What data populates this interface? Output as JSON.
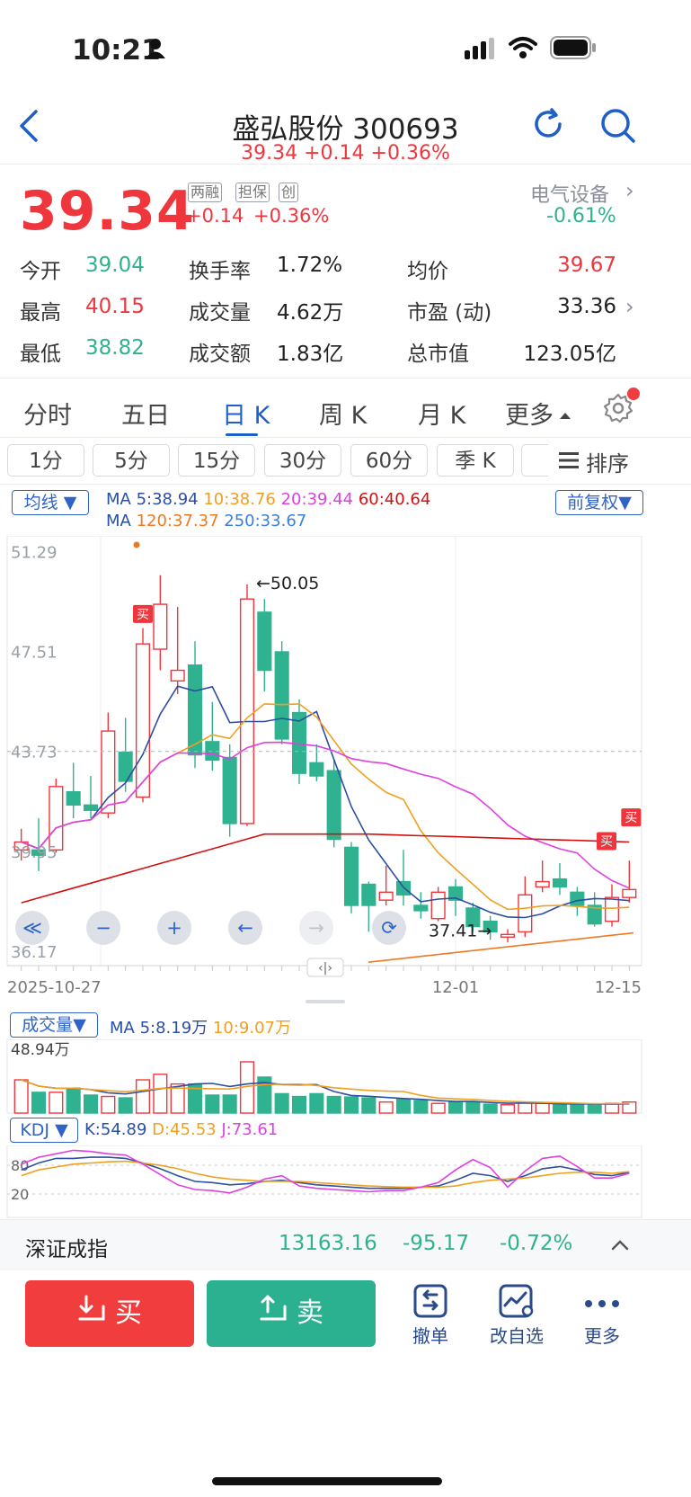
{
  "status_bar": {
    "time": "10:21"
  },
  "header": {
    "title": "盛弘股份 300693",
    "subtitle": "39.34 +0.14 +0.36%"
  },
  "quote": {
    "price": "39.34",
    "tags": [
      "两融",
      "担保",
      "创"
    ],
    "change": "+0.14",
    "change_pct": "+0.36%",
    "sector": "电气设备",
    "sector_pct": "-0.61%",
    "stats": [
      {
        "label": "今开",
        "value": "39.04",
        "color": "#2fb28f"
      },
      {
        "label": "换手率",
        "value": "1.72%",
        "color": "#222"
      },
      {
        "label": "均价",
        "value": "39.67",
        "color": "#f0363d"
      },
      {
        "label": "最高",
        "value": "40.15",
        "color": "#f0363d"
      },
      {
        "label": "成交量",
        "value": "4.62万",
        "color": "#222"
      },
      {
        "label": "市盈 (动)",
        "value": "33.36",
        "color": "#222"
      },
      {
        "label": "最低",
        "value": "38.82",
        "color": "#2fb28f"
      },
      {
        "label": "成交额",
        "value": "1.83亿",
        "color": "#222"
      },
      {
        "label": "总市值",
        "value": "123.05亿",
        "color": "#222"
      }
    ]
  },
  "tabs": [
    "分时",
    "五日",
    "日 K",
    "周 K",
    "月 K",
    "更多"
  ],
  "active_tab": "日 K",
  "subtabs": [
    "1分",
    "5分",
    "15分",
    "30分",
    "60分",
    "季 K"
  ],
  "sort_label": "排序",
  "ma_legend": {
    "selector": "均线",
    "fq": "前复权",
    "row1": [
      "MA",
      "5:38.94",
      "10:38.76",
      "20:39.44",
      "60:40.64"
    ],
    "row2": [
      "MA",
      "120:37.37",
      "250:33.67"
    ],
    "colors": {
      "ma5": "#2b4fa3",
      "ma10": "#f0a020",
      "ma20": "#e040e0",
      "ma60": "#d21010",
      "ma120": "#f07820",
      "ma250": "#3a7fe0"
    }
  },
  "kline": {
    "y_ticks": [
      "51.29",
      "47.51",
      "43.73",
      "39.95",
      "36.17"
    ],
    "x_ticks": [
      "2025-10-27",
      "12-01",
      "12-15"
    ],
    "high_marker": "←50.05",
    "low_marker": "37.41→",
    "buy_tag": "买",
    "candles": [
      {
        "o": 40.0,
        "c": 40.3,
        "h": 40.8,
        "l": 39.6
      },
      {
        "o": 40.0,
        "c": 39.8,
        "h": 41.2,
        "l": 39.2
      },
      {
        "o": 40.0,
        "c": 42.4,
        "h": 42.7,
        "l": 39.9
      },
      {
        "o": 42.2,
        "c": 41.7,
        "h": 43.3,
        "l": 41.2
      },
      {
        "o": 41.7,
        "c": 41.5,
        "h": 42.8,
        "l": 41.2
      },
      {
        "o": 41.4,
        "c": 44.5,
        "h": 45.2,
        "l": 41.2
      },
      {
        "o": 43.7,
        "c": 42.6,
        "h": 45.0,
        "l": 42.2
      },
      {
        "o": 42.0,
        "c": 47.8,
        "h": 48.4,
        "l": 41.8
      },
      {
        "o": 47.6,
        "c": 49.3,
        "h": 50.4,
        "l": 46.8
      },
      {
        "o": 46.4,
        "c": 46.8,
        "h": 49.2,
        "l": 45.9
      },
      {
        "o": 47.0,
        "c": 43.6,
        "h": 47.9,
        "l": 43.1
      },
      {
        "o": 44.1,
        "c": 43.4,
        "h": 45.6,
        "l": 43.0
      },
      {
        "o": 43.5,
        "c": 41.0,
        "h": 44.0,
        "l": 40.5
      },
      {
        "o": 41.0,
        "c": 49.5,
        "h": 50.05,
        "l": 40.9
      },
      {
        "o": 49.0,
        "c": 46.8,
        "h": 49.5,
        "l": 46.0
      },
      {
        "o": 47.5,
        "c": 44.2,
        "h": 47.9,
        "l": 44.0
      },
      {
        "o": 45.2,
        "c": 42.9,
        "h": 45.7,
        "l": 42.5
      },
      {
        "o": 43.3,
        "c": 42.8,
        "h": 44.0,
        "l": 42.6
      },
      {
        "o": 43.0,
        "c": 40.4,
        "h": 43.4,
        "l": 40.1
      },
      {
        "o": 40.1,
        "c": 37.9,
        "h": 40.3,
        "l": 37.6
      },
      {
        "o": 38.7,
        "c": 37.9,
        "h": 38.8,
        "l": 36.9
      },
      {
        "o": 38.1,
        "c": 38.4,
        "h": 39.4,
        "l": 37.9
      },
      {
        "o": 38.8,
        "c": 38.3,
        "h": 40.0,
        "l": 37.9
      },
      {
        "o": 37.9,
        "c": 37.7,
        "h": 38.4,
        "l": 37.4
      },
      {
        "o": 37.4,
        "c": 38.4,
        "h": 38.6,
        "l": 37.3
      },
      {
        "o": 38.6,
        "c": 38.1,
        "h": 38.9,
        "l": 37.5
      },
      {
        "o": 37.8,
        "c": 37.1,
        "h": 38.0,
        "l": 36.9
      },
      {
        "o": 37.3,
        "c": 36.9,
        "h": 37.5,
        "l": 36.6
      },
      {
        "o": 36.7,
        "c": 36.8,
        "h": 37.0,
        "l": 36.5
      },
      {
        "o": 36.9,
        "c": 38.3,
        "h": 39.0,
        "l": 36.7
      },
      {
        "o": 38.6,
        "c": 38.8,
        "h": 39.6,
        "l": 38.4
      },
      {
        "o": 38.9,
        "c": 38.6,
        "h": 39.5,
        "l": 38.3
      },
      {
        "o": 38.4,
        "c": 37.9,
        "h": 38.6,
        "l": 37.5
      },
      {
        "o": 37.9,
        "c": 37.2,
        "h": 38.4,
        "l": 37.1
      },
      {
        "o": 37.3,
        "c": 38.2,
        "h": 38.7,
        "l": 37.1
      },
      {
        "o": 38.2,
        "c": 38.5,
        "h": 39.6,
        "l": 38.0
      }
    ]
  },
  "volume": {
    "selector": "成交量",
    "ma_text": [
      "MA",
      "5:8.19万",
      "10:9.07万"
    ],
    "max_label": "48.94万",
    "values_wan": [
      12,
      7.5,
      7.5,
      9,
      6.5,
      6,
      5.5,
      12,
      14,
      10.5,
      10.5,
      6.5,
      6.5,
      18.5,
      13,
      7,
      6,
      7,
      6,
      5.8,
      5.5,
      4,
      5,
      4.5,
      3.5,
      4,
      4,
      3.2,
      3,
      4,
      3.5,
      3,
      3,
      3,
      3.5,
      4
    ]
  },
  "kdj": {
    "selector": "KDJ",
    "k": "K:54.89",
    "d": "D:45.53",
    "j": "J:73.61",
    "levels": [
      "80",
      "20"
    ]
  },
  "index_bar": {
    "name": "深证成指",
    "value": "13163.16",
    "change": "-95.17",
    "pct": "-0.72%"
  },
  "actions": {
    "buy": "买",
    "sell": "卖",
    "tools": [
      "撤单",
      "改自选",
      "更多"
    ]
  }
}
